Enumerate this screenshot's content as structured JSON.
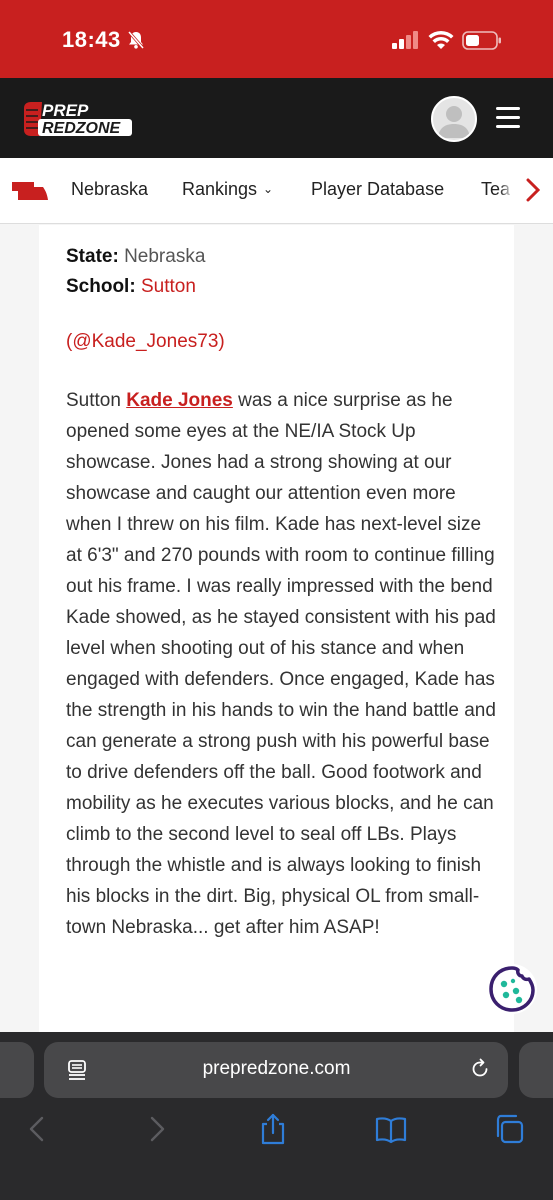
{
  "status_bar": {
    "time": "18:43"
  },
  "header": {
    "logo_line1": "PREP",
    "logo_line2": "REDZONE"
  },
  "nav": {
    "items": [
      {
        "label": "Nebraska"
      },
      {
        "label": "Rankings"
      },
      {
        "label": "Player Database"
      },
      {
        "label": "Tea"
      }
    ]
  },
  "profile": {
    "state_label": "State:",
    "state_value": "Nebraska",
    "school_label": "School:",
    "school_value": "Sutton",
    "handle": "(@Kade_Jones73)"
  },
  "article": {
    "lead": "Sutton ",
    "player_link": "Kade Jones",
    "body": " was a nice surprise as he opened some eyes at the NE/IA Stock Up showcase. Jones had a strong showing at our showcase and caught our attention even more when I threw on his film. Kade has next-level size at 6'3\" and 270 pounds with room to continue filling out his frame. I was really impressed with the bend Kade showed, as he stayed consistent with his pad level when shooting out of his stance and when engaged with defenders. Once engaged, Kade has the strength in his hands to win the hand battle and can generate a strong push with his powerful base to drive defenders off the ball. Good footwork and mobility as he executes various blocks, and he can climb to the second level to seal off LBs. Plays through the whistle and is always looking to finish his blocks in the dirt. Big, physical OL from small-town Nebraska... get after him ASAP!"
  },
  "browser": {
    "url": "prepredzone.com"
  },
  "colors": {
    "brand_red": "#c8201f",
    "header_dark": "#1a1a1a",
    "safari_bar": "#2a2a2c",
    "cookie_teal": "#1fb89a",
    "cookie_purple": "#3a1f6e"
  },
  "icons": [
    "bell-off-icon",
    "signal-icon",
    "wifi-icon",
    "battery-icon",
    "nebraska-state-icon",
    "chevron-down-icon",
    "chevron-right-icon",
    "cookie-icon",
    "reader-icon",
    "reload-icon",
    "back-icon",
    "forward-icon",
    "share-icon",
    "bookmarks-icon",
    "tabs-icon"
  ]
}
